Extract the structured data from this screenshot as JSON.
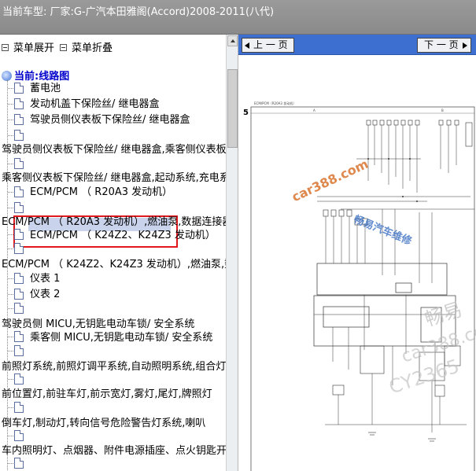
{
  "window": {
    "title": "当前车型:   厂家:G-广汽本田雅阁(Accord)2008-2011(八代)"
  },
  "left_pane": {
    "expand_label": "菜单展开",
    "collapse_label": "菜单折叠",
    "root_label": "当前:线路图",
    "items": [
      {
        "label": "蓄电池"
      },
      {
        "label": "发动机盖下保险丝/ 继电器盒"
      },
      {
        "label": "驾驶员侧仪表板下保险丝/ 继电器盒"
      },
      {
        "label": "驾驶员侧仪表板下保险丝/ 继电器盒,乘客侧仪表板"
      },
      {
        "label": "乘客侧仪表板下保险丝/ 继电器盒,起动系统,充电系"
      },
      {
        "label": "ECM/PCM （ R20A3 发动机）"
      },
      {
        "label": "ECM/PCM （ R20A3 发动机）,燃油泵,数据连接器"
      },
      {
        "label": "ECM/PCM （ K24Z2、K24Z3 发动机）"
      },
      {
        "label": "ECM/PCM （ K24Z2、K24Z3 发动机）,燃油泵,数"
      },
      {
        "label": "仪表 1"
      },
      {
        "label": "仪表 2"
      },
      {
        "label": "驾驶员侧 MICU,无钥匙电动车锁/ 安全系统"
      },
      {
        "label": "乘客侧 MICU,无钥匙电动车锁/ 安全系统"
      },
      {
        "label": "前照灯系统,前照灯调平系统,自动照明系统,组合灯"
      },
      {
        "label": "前位置灯,前驻车灯,前示宽灯,雾灯,尾灯,牌照灯"
      },
      {
        "label": "倒车灯,制动灯,转向信号危险警告灯系统,喇叭"
      },
      {
        "label": "车内照明灯、点烟器、附件电源插座、点火钥匙开"
      }
    ]
  },
  "right_pane": {
    "prev_label": "上 一 页",
    "next_label": "下 一 页",
    "diagram_page_number": "5",
    "diagram_header": "ECM/PCM（R20A3 发动机）",
    "watermarks": {
      "site": "car388.com",
      "brand": "畅易汽车维修",
      "faint_1": "畅易",
      "faint_2": "car388.com",
      "faint_3": "CY2365"
    }
  },
  "colors": {
    "titlebar": "#8f8f8f",
    "navbar": "#3c6fd0",
    "selection_outline": "#e0191f",
    "root_label": "#0000cc"
  }
}
